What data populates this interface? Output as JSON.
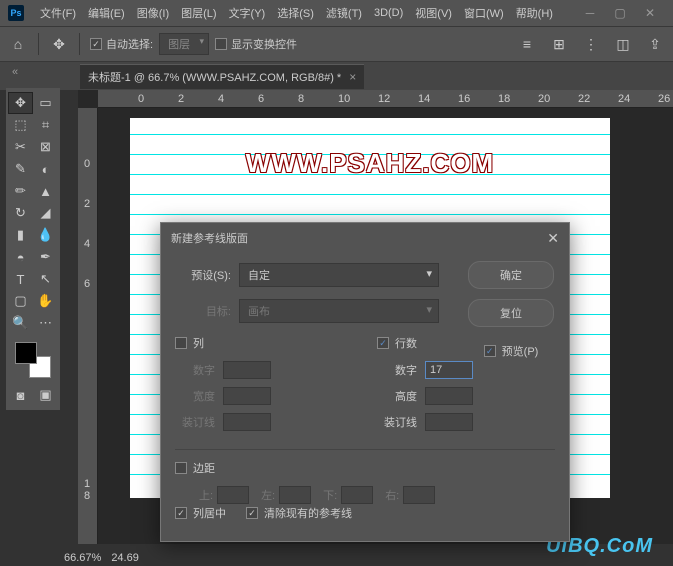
{
  "menu": {
    "file": "文件(F)",
    "edit": "编辑(E)",
    "image": "图像(I)",
    "layer": "图层(L)",
    "type": "文字(Y)",
    "select": "选择(S)",
    "filter": "滤镜(T)",
    "threeD": "3D(D)",
    "view": "视图(V)",
    "window": "窗口(W)",
    "help": "帮助(H)"
  },
  "toolbar": {
    "auto_select": "自动选择:",
    "layer": "图层",
    "show_transform": "显示变换控件"
  },
  "doc_tab": "未标题-1 @ 66.7% (WWW.PSAHZ.COM, RGB/8#) *",
  "watermark": "WWW.PSAHZ.COM",
  "footer_wm": "UiBQ.CoM",
  "status": {
    "zoom": "66.67%",
    "other": "24.69"
  },
  "ruler_h": [
    "0",
    "2",
    "4",
    "6",
    "8",
    "10",
    "12",
    "14",
    "16",
    "18",
    "20",
    "22",
    "24",
    "26"
  ],
  "ruler_v": [
    "0",
    "2",
    "4",
    "6",
    "1 8"
  ],
  "dialog": {
    "title": "新建参考线版面",
    "preset_label": "预设(S):",
    "preset_value": "自定",
    "target_label": "目标:",
    "target_value": "画布",
    "columns": "列",
    "rows": "行数",
    "number": "数字",
    "width": "宽度",
    "height": "高度",
    "gutter": "装订线",
    "rows_number_value": "17",
    "margin": "边距",
    "top": "上:",
    "left": "左:",
    "bottom": "下:",
    "right": "右:",
    "ok": "确定",
    "reset": "复位",
    "preview": "预览(P)",
    "center_columns": "列居中",
    "clear_existing": "清除现有的参考线"
  }
}
